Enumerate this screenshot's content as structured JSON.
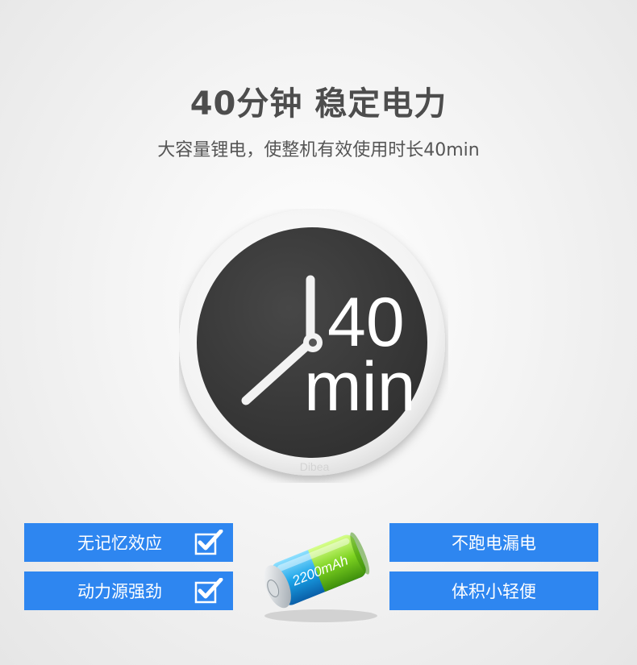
{
  "header": {
    "title": "40分钟 稳定电力",
    "subtitle": "大容量锂电，使整机有效使用时长40min"
  },
  "clock": {
    "number": "40",
    "unit": "min",
    "brand": "Dibea"
  },
  "features_left": [
    {
      "label": "无记忆效应",
      "checked": true
    },
    {
      "label": "动力源强劲",
      "checked": true
    }
  ],
  "features_right": [
    {
      "label": "不跑电漏电"
    },
    {
      "label": "体积小轻便"
    }
  ],
  "battery": {
    "capacity": "2200mAh"
  },
  "colors": {
    "accent_blue": "#2e86f0",
    "clock_face": "#3a3a3a",
    "battery_green": "#7ed321",
    "battery_blue": "#1aa3e8"
  }
}
